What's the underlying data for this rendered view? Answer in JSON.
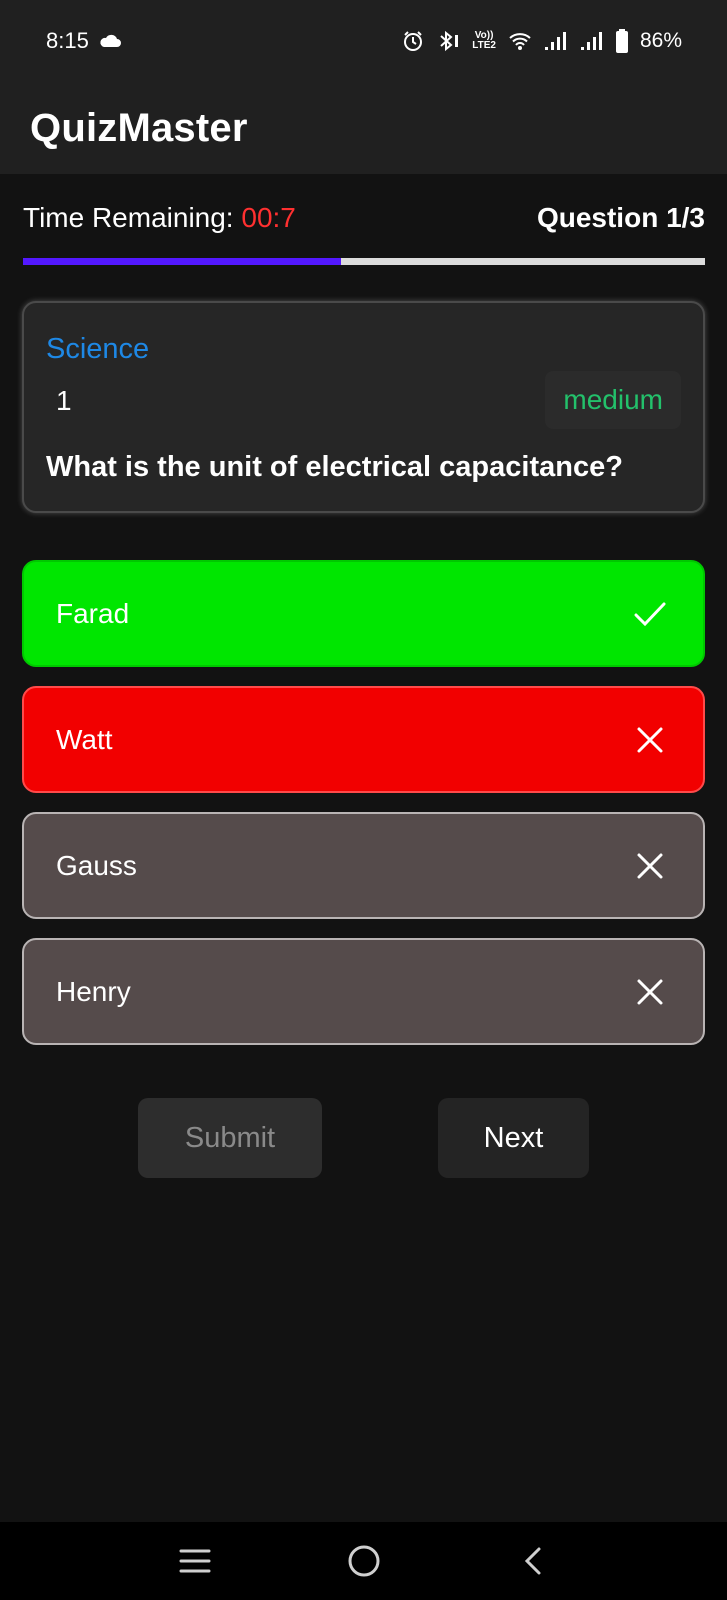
{
  "status_bar": {
    "time": "8:15",
    "battery": "86%",
    "icons": [
      "cloud-icon",
      "alarm-icon",
      "bluetooth-icon",
      "volte-icon",
      "wifi-icon",
      "signal-icon",
      "signal-icon",
      "battery-icon"
    ],
    "volte_top": "Vo))",
    "volte_bottom": "LTE2"
  },
  "app": {
    "title": "QuizMaster"
  },
  "quiz": {
    "time_label": "Time Remaining: ",
    "time_value": "00:7",
    "question_counter": "Question 1/3",
    "progress": 0.467,
    "category": "Science",
    "question_number": "1",
    "difficulty": "medium",
    "question_text": "What is the unit of electrical capacitance?"
  },
  "options": [
    {
      "label": "Farad",
      "state": "correct",
      "icon": "check-icon"
    },
    {
      "label": "Watt",
      "state": "wrong",
      "icon": "close-icon"
    },
    {
      "label": "Gauss",
      "state": "neutral",
      "icon": "close-icon"
    },
    {
      "label": "Henry",
      "state": "neutral",
      "icon": "close-icon"
    }
  ],
  "buttons": {
    "submit": "Submit",
    "next": "Next"
  },
  "colors": {
    "accent_progress": "#5318ff",
    "timer": "#ff3030",
    "category": "#1e88e5",
    "difficulty": "#23c16b",
    "correct": "#00e600",
    "wrong": "#f20000",
    "neutral": "#554b4b"
  },
  "nav": [
    "menu-icon",
    "home-icon",
    "back-icon"
  ]
}
